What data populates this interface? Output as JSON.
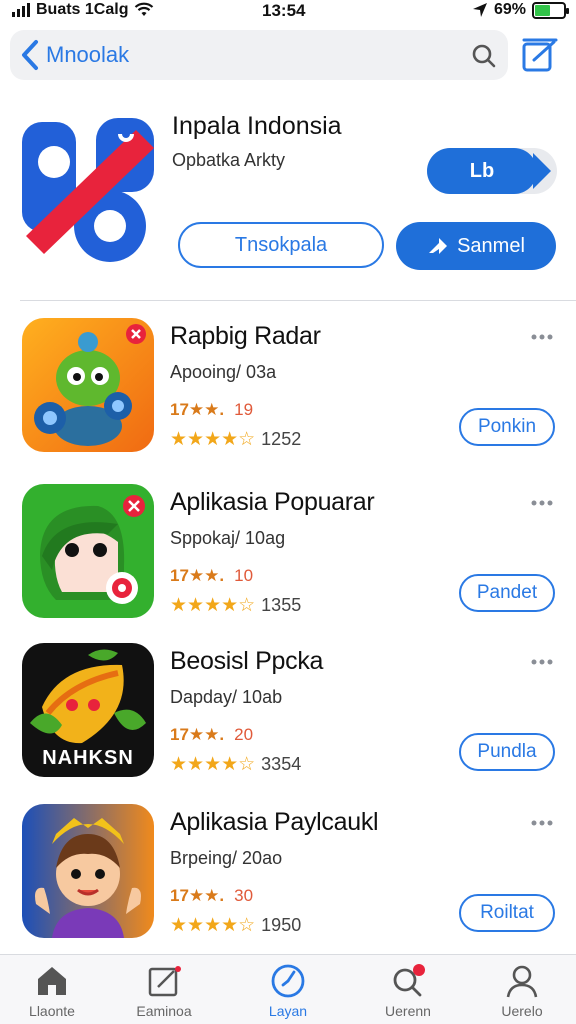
{
  "status_bar": {
    "carrier": "Buats 1Calg",
    "time": "13:54",
    "battery": "69%"
  },
  "search": {
    "query": "Mnoolak"
  },
  "featured": {
    "title": "Inpala Indonsia",
    "subtitle": "Opbatka Arkty",
    "get_label": "Lb",
    "secondary_label": "Tnsokpala",
    "primary_label": "Sanmel"
  },
  "apps": [
    {
      "name": "Rapbig Radar",
      "meta": "Apooing/ 03a",
      "small_rating": "17★★.",
      "small_rating_num": "19",
      "rating_count": "1252",
      "rating_value": 4.5,
      "action_label": "Ponkin"
    },
    {
      "name": "Aplikasia Popuarar",
      "meta": "Sppokaj/ 10ag",
      "small_rating": "17★★.",
      "small_rating_num": "10",
      "rating_count": "1355",
      "rating_value": 4.5,
      "action_label": "Pandet"
    },
    {
      "name": "Beosisl Ppcka",
      "meta": "Dapday/ 10ab",
      "small_rating": "17★★.",
      "small_rating_num": "20",
      "rating_count": "3354",
      "rating_value": 4.5,
      "action_label": "Pundla"
    },
    {
      "name": "Aplikasia Paylcaukl",
      "meta": "Brpeing/ 20ao",
      "small_rating": "17★★.",
      "small_rating_num": "30",
      "rating_count": "1950",
      "rating_value": 4.5,
      "action_label": "Roiltat"
    }
  ],
  "icon_texts": {
    "app3_banner": "NAHKSN"
  },
  "tabs": [
    {
      "label": "Llaonte",
      "icon": "home-icon"
    },
    {
      "label": "Eaminoa",
      "icon": "edit-icon"
    },
    {
      "label": "Layan",
      "icon": "compass-icon"
    },
    {
      "label": "Uerenn",
      "icon": "search-icon"
    },
    {
      "label": "Uerelo",
      "icon": "person-icon"
    }
  ],
  "colors": {
    "accent": "#2a79e4",
    "button_blue": "#1f6fd9",
    "star": "#f2a71a"
  }
}
